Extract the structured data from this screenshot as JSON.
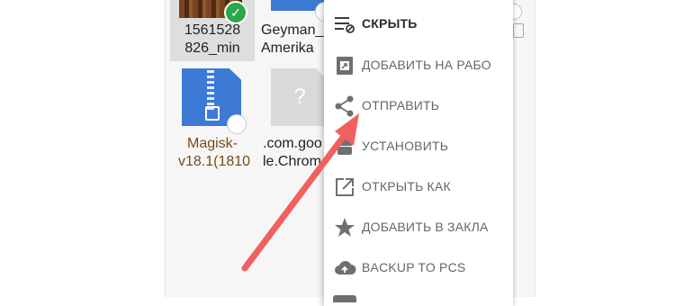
{
  "files": [
    {
      "name_line1": "1561528",
      "name_line2": "826_min",
      "selected": true
    },
    {
      "name_line1": "Geyman_",
      "name_line2": "Amerika"
    },
    {
      "name_line1": "Magisk-",
      "name_line2": "v18.1(1810"
    },
    {
      "name_line1": ".com.goo",
      "name_line2": "le.Chrom",
      "icon_glyph": "?"
    }
  ],
  "context_menu": {
    "items": [
      {
        "label": "СКРЫТЬ",
        "icon": "hide-list-icon"
      },
      {
        "label": "ДОБАВИТЬ НА РАБО",
        "icon": "add-to-home-icon"
      },
      {
        "label": "ОТПРАВИТЬ",
        "icon": "share-icon"
      },
      {
        "label": "УСТАНОВИТЬ",
        "icon": "android-install-icon"
      },
      {
        "label": "ОТКРЫТЬ КАК",
        "icon": "open-external-icon"
      },
      {
        "label": "ДОБАВИТЬ В ЗАКЛА",
        "icon": "star-bookmark-icon"
      },
      {
        "label": "BACKUP TO PCS",
        "icon": "cloud-upload-icon"
      }
    ]
  },
  "colors": {
    "arrow": "#f0605f",
    "selected_check": "#2aa84a",
    "file_icon_blue": "#3d7ad6",
    "menu_text": "#666666",
    "menu_icon": "#6f6f6f"
  }
}
